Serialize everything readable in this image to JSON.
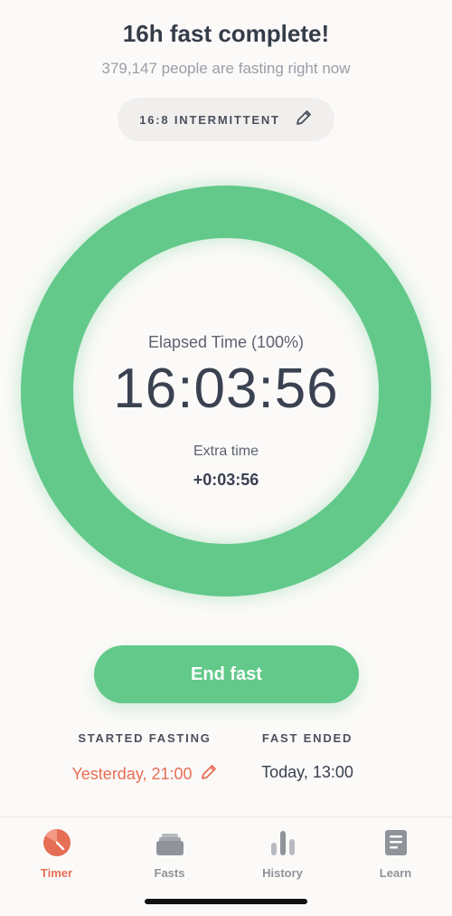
{
  "header": {
    "title": "16h fast complete!",
    "subtitle": "379,147 people are fasting right now"
  },
  "plan": {
    "label": "16:8 INTERMITTENT",
    "icon": "pencil-icon"
  },
  "timer": {
    "progress_fraction": 1.0,
    "elapsed_label": "Elapsed Time (100%)",
    "elapsed_value": "16:03:56",
    "extra_label": "Extra time",
    "extra_value": "+0:03:56",
    "ring_color": "#62c98a"
  },
  "actions": {
    "end_fast_label": "End fast"
  },
  "summary": {
    "started_header": "STARTED FASTING",
    "started_value": "Yesterday, 21:00",
    "ended_header": "FAST ENDED",
    "ended_value": "Today, 13:00"
  },
  "tabs": [
    {
      "label": "Timer",
      "icon": "timer-icon",
      "active": true
    },
    {
      "label": "Fasts",
      "icon": "fasts-stack-icon",
      "active": false
    },
    {
      "label": "History",
      "icon": "history-bars-icon",
      "active": false
    },
    {
      "label": "Learn",
      "icon": "learn-book-icon",
      "active": false
    }
  ],
  "colors": {
    "accent_green": "#62c98a",
    "accent_orange": "#e66e55",
    "background": "#fcfaf9"
  }
}
